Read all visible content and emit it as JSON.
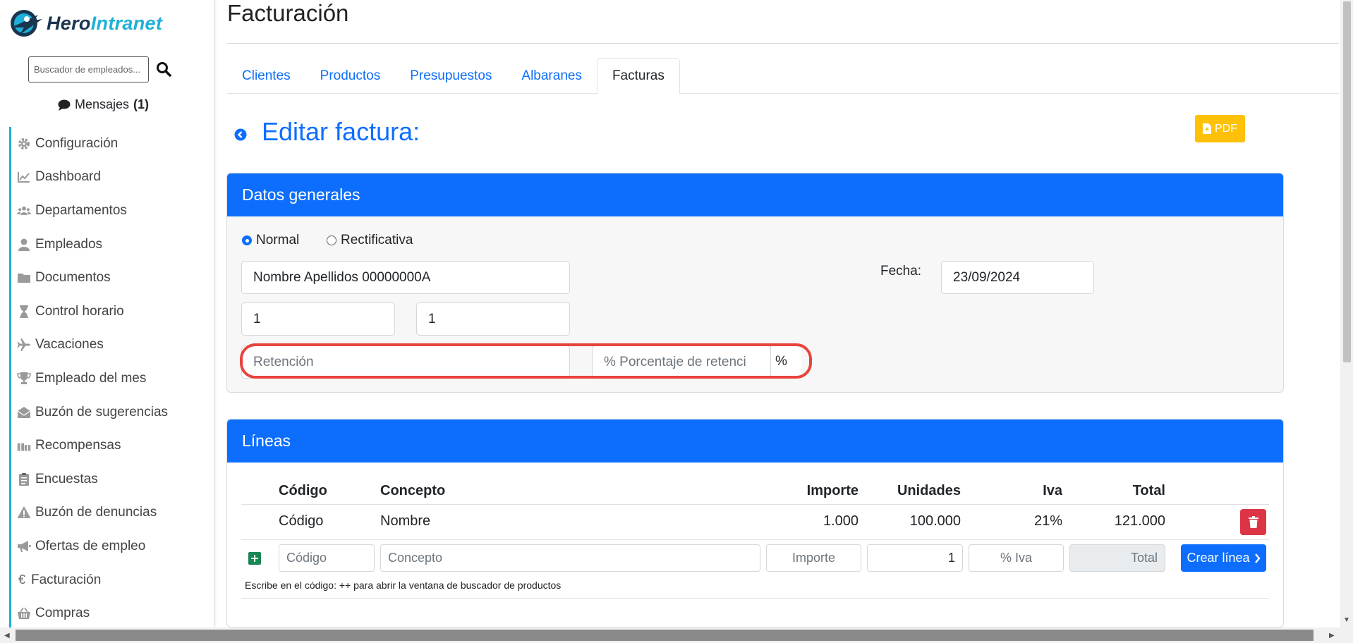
{
  "brand": {
    "name_part1": "Hero",
    "name_part2": "Intranet"
  },
  "search": {
    "placeholder": "Buscador de empleados..."
  },
  "messages": {
    "label": "Mensajes",
    "count": "(1)"
  },
  "sidebar": {
    "items": [
      {
        "label": "Configuración",
        "icon": "gear-icon"
      },
      {
        "label": "Dashboard",
        "icon": "chart-line-icon"
      },
      {
        "label": "Departamentos",
        "icon": "users-icon"
      },
      {
        "label": "Empleados",
        "icon": "user-icon"
      },
      {
        "label": "Documentos",
        "icon": "folder-icon"
      },
      {
        "label": "Control horario",
        "icon": "hourglass-icon"
      },
      {
        "label": "Vacaciones",
        "icon": "plane-icon"
      },
      {
        "label": "Empleado del mes",
        "icon": "trophy-icon"
      },
      {
        "label": "Buzón de sugerencias",
        "icon": "envelope-open-icon"
      },
      {
        "label": "Recompensas",
        "icon": "gifts-icon"
      },
      {
        "label": "Encuestas",
        "icon": "clipboard-icon"
      },
      {
        "label": "Buzón de denuncias",
        "icon": "warning-icon"
      },
      {
        "label": "Ofertas de empleo",
        "icon": "bullhorn-icon"
      },
      {
        "label": "Facturación",
        "icon": "euro-icon"
      },
      {
        "label": "Compras",
        "icon": "basket-icon"
      }
    ]
  },
  "page": {
    "title": "Facturación"
  },
  "tabs": [
    "Clientes",
    "Productos",
    "Presupuestos",
    "Albaranes",
    "Facturas"
  ],
  "active_tab": "Facturas",
  "edit": {
    "title": "Editar factura:",
    "pdf_label": "PDF"
  },
  "general": {
    "header": "Datos generales",
    "radio_normal": "Normal",
    "radio_rectificativa": "Rectificativa",
    "selected_type": "Normal",
    "client_value": "Nombre Apellidos 00000000A",
    "fecha_label": "Fecha:",
    "fecha_value": "23/09/2024",
    "field_a_value": "1",
    "field_b_value": "1",
    "retencion_placeholder": "Retención",
    "porcentaje_placeholder": "% Porcentaje de retenci",
    "percent_sign": "%"
  },
  "lines": {
    "header": "Líneas",
    "columns": {
      "codigo": "Código",
      "concepto": "Concepto",
      "importe": "Importe",
      "unidades": "Unidades",
      "iva": "Iva",
      "total": "Total"
    },
    "row": {
      "codigo": "Código",
      "concepto": "Nombre",
      "importe": "1.000",
      "unidades": "100.000",
      "iva": "21%",
      "total": "121.000"
    },
    "new_line": {
      "codigo_placeholder": "Código",
      "concepto_placeholder": "Concepto",
      "importe_placeholder": "Importe",
      "unidades_value": "1",
      "iva_placeholder": "% Iva",
      "total_placeholder": "Total",
      "create_label": "Crear línea"
    },
    "hint": "Escribe en el código: ++ para abrir la ventana de buscador de productos"
  },
  "colors": {
    "primary": "#0d6efd",
    "brand_dark": "#1a3550",
    "brand_light": "#1fb0d8",
    "pdf": "#ffc107",
    "danger": "#dc3545",
    "success": "#198754",
    "highlight": "#e8433d"
  }
}
